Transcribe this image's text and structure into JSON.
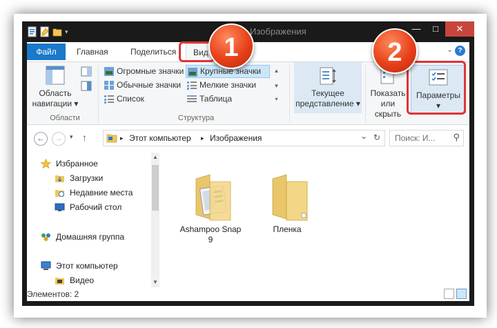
{
  "window": {
    "title": "Изображения",
    "min_label": "—",
    "max_label": "□",
    "close_label": "✕"
  },
  "ribbon_tabs": {
    "file": "Файл",
    "home": "Главная",
    "share": "Поделиться",
    "view": "Вид",
    "help": "?"
  },
  "ribbon": {
    "nav_pane_line1": "Область",
    "nav_pane_line2": "навигации ▾",
    "group_panes": "Области",
    "layout": {
      "huge_icons": "Огромные значки",
      "large_icons": "Крупные значки",
      "normal_icons": "Обычные значки",
      "small_icons": "Мелкие значки",
      "list": "Список",
      "details": "Таблица"
    },
    "group_layout": "Структура",
    "current_view_line1": "Текущее",
    "current_view_line2": "представление ▾",
    "show_hide_line1": "Показать",
    "show_hide_line2": "или скрыть",
    "options_line1": "Параметры",
    "options_line2": "▾"
  },
  "address": {
    "sep1": "▸",
    "computer": "Этот компьютер",
    "sep2": "▸",
    "folder": "Изображения",
    "dropdown": "⌄",
    "refresh": "↻",
    "search_placeholder": "Поиск: И...",
    "search_icon": "⚲"
  },
  "nav_buttons": {
    "back": "←",
    "forward": "→",
    "recent": "▾",
    "up": "↑"
  },
  "nav_pane": {
    "favorites": "Избранное",
    "downloads": "Загрузки",
    "recent_places": "Недавние места",
    "desktop": "Рабочий стол",
    "homegroup": "Домашняя группа",
    "this_pc": "Этот компьютер",
    "video": "Видео"
  },
  "files": [
    {
      "name_line1": "Ashampoo Snap",
      "name_line2": "9",
      "icon": "folder-with-screenshot-icon"
    },
    {
      "name_line1": "Пленка",
      "name_line2": "",
      "icon": "folder-icon"
    }
  ],
  "status": {
    "items": "Элементов: 2"
  },
  "annotations": {
    "badge1": "1",
    "badge2": "2",
    "badge_color": "#e8401a",
    "highlight_color": "#e03333"
  }
}
